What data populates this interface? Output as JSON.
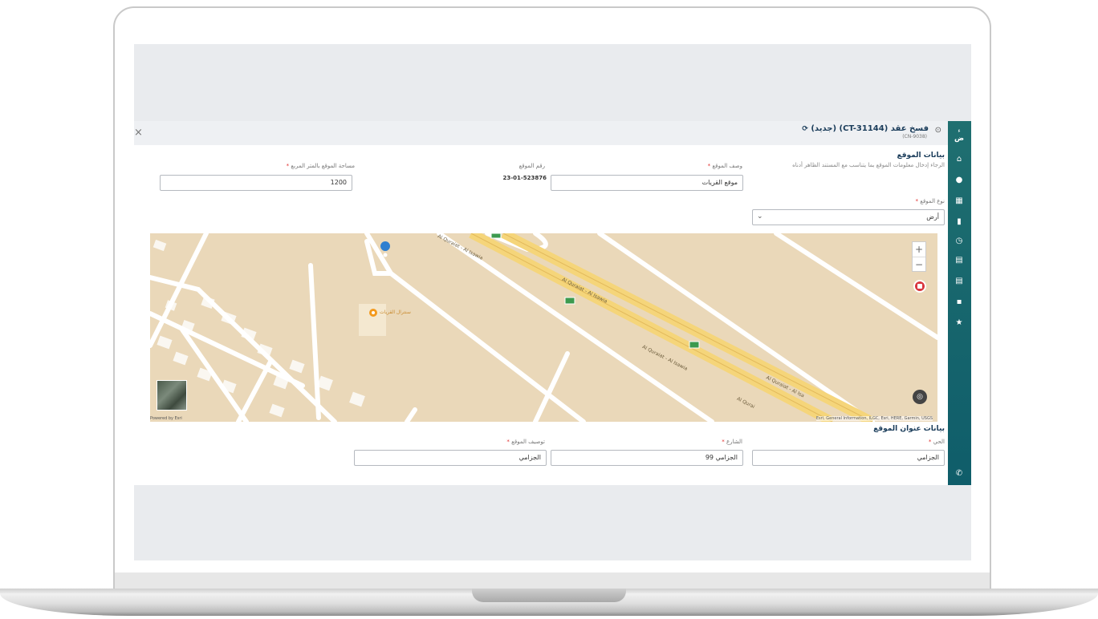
{
  "window": {
    "title": "فسخ عقد (CT-31144) (جديد)",
    "subtitle": "(CN-9038)",
    "close_label": "×",
    "refresh_icon": "refresh-icon",
    "info_icon": "info-icon"
  },
  "sidebar": {
    "logo_text": "ص<br>",
    "icons": [
      "home-icon",
      "globe-icon",
      "grid-icon",
      "chart-icon",
      "clock-icon",
      "document-icon",
      "file-icon",
      "chat-icon",
      "star-icon",
      "phone-icon"
    ]
  },
  "site_section": {
    "title": "بيانات الموقع",
    "hint": "الرجاء إدخال معلومات الموقع بما يتناسب مع المستند الظاهر أدناه",
    "site_description_label": "وصف الموقع",
    "site_description_value": "موقع القريات",
    "site_number_label": "رقم الموقع",
    "site_number_value": "23-01-523876",
    "site_area_label": "مساحة الموقع بالمتر المربع",
    "site_area_value": "1200",
    "site_type_label": "نوع الموقع",
    "site_type_value": "أرض"
  },
  "map": {
    "road_labels": [
      "Al Quraiat - Al Isawia",
      "Al Quraiat - Al Isawia",
      "Al Quraiat - Al Isawia",
      "Al Qurai",
      "Al Quraiat - Al Isa"
    ],
    "place_label": "سنترال القريات",
    "zoom_in": "+",
    "zoom_out": "−",
    "powered_by": "Powered by Esri",
    "attribution": "Esri, General Information, ILGC, Esri, HERE, Garmin, USGS"
  },
  "address_section": {
    "title": "بيانات عنوان الموقع",
    "district_label": "الحي",
    "district_value": "الجزامي",
    "street_label": "الشارع",
    "street_value": "الجزامي 99",
    "site_desc_label": "توصيف الموقع",
    "site_desc_value": "الجزامي"
  }
}
